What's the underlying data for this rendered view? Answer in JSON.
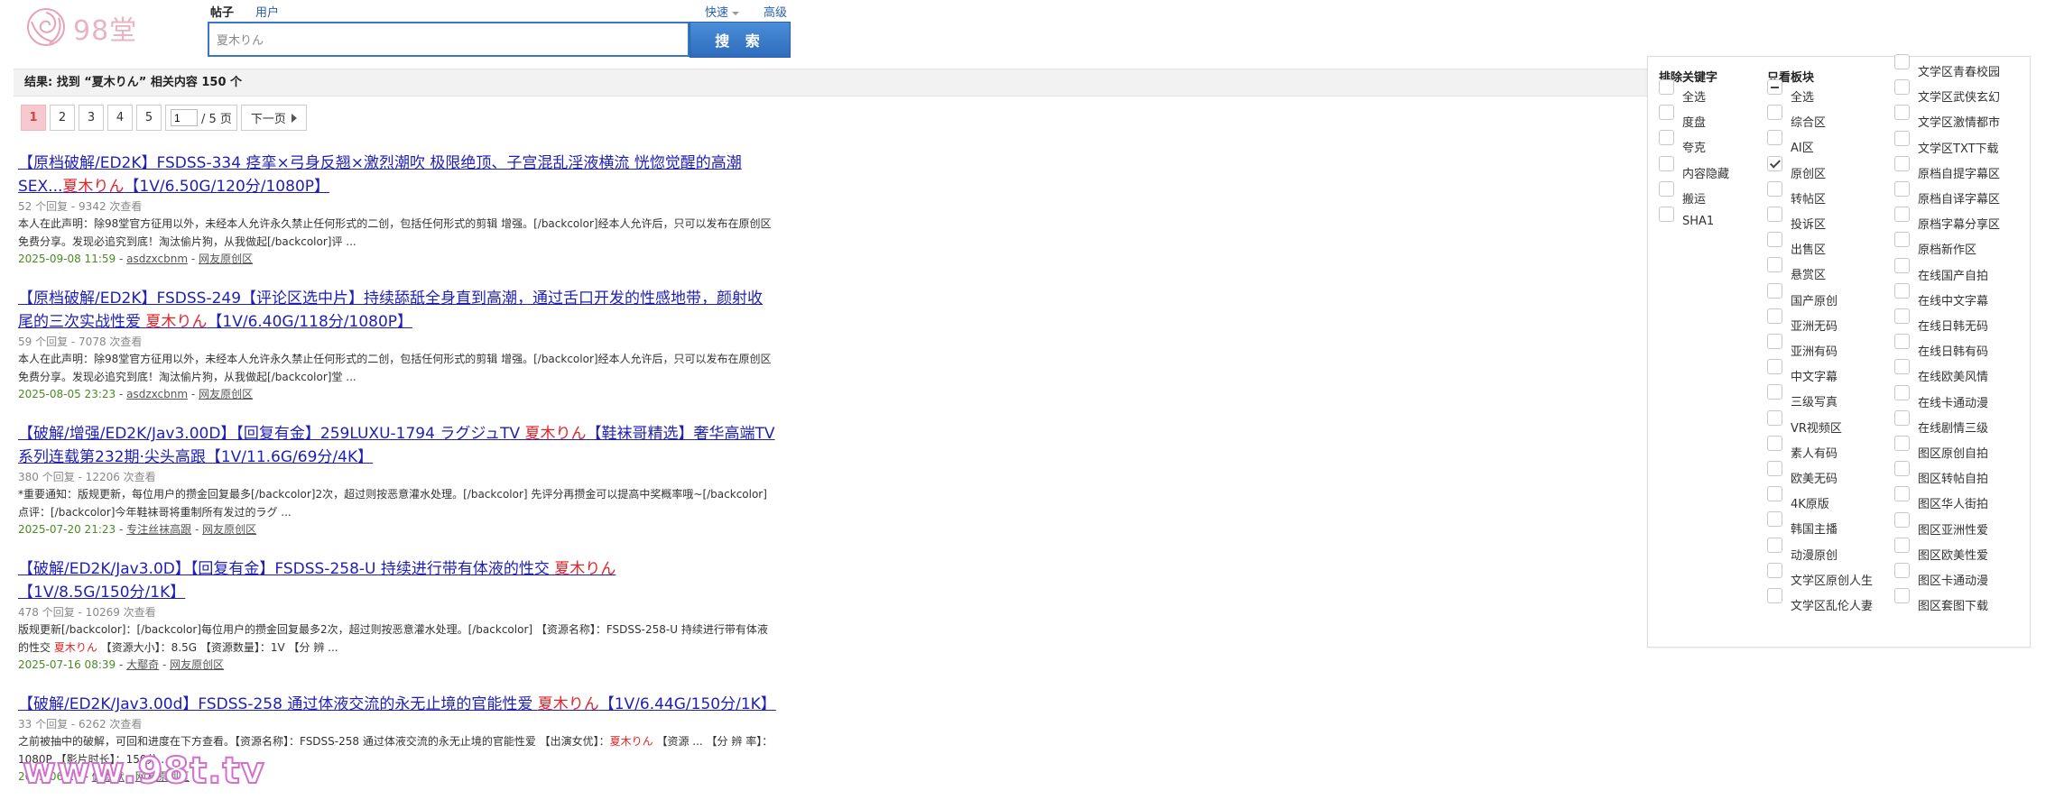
{
  "header": {
    "logo_text": "98堂",
    "tabs": [
      {
        "label": "帖子",
        "active": true
      },
      {
        "label": "用户",
        "active": false
      }
    ],
    "quick_label": "快速",
    "advanced_label": "高级",
    "search_value": "夏木りん",
    "search_button": "搜 索"
  },
  "result_summary": "结果: 找到 “夏木りん” 相关内容 150 个",
  "pager": {
    "pages": [
      "1",
      "2",
      "3",
      "4",
      "5"
    ],
    "current": "1",
    "page_input": "1",
    "total_text": "/ 5 页",
    "next_label": "下一页"
  },
  "results": [
    {
      "title_before": "【原档破解/ED2K】FSDSS-334 痉挛×弓身反翘×激烈潮吹 极限绝顶、子宫混乱淫液横流 恍惚觉醒的高潮SEX...",
      "title_hl": "夏木りん",
      "title_after": "【1V/6.50G/120分/1080P】",
      "meta": "52 个回复 - 9342 次查看",
      "snippet_before": "本人在此声明：除98堂官方征用以外，未经本人允许永久禁止任何形式的二创，包括任何形式的剪辑 增强。[/backcolor]经本人允许后，只可以发布在原创区免费分享。发现必追究到底！淘汰偷片狗，从我做起[/backcolor]评 ...",
      "snippet_hl": "",
      "snippet_after": "",
      "date": "2025-09-08 11:59",
      "author": "asdzxcbnm",
      "forum": "网友原创区"
    },
    {
      "title_before": "【原档破解/ED2K】FSDSS-249【评论区选中片】持续舔舐全身直到高潮，通过舌口开发的性感地带，颜射收尾的三次实战性爱 ",
      "title_hl": "夏木りん",
      "title_after": "【1V/6.40G/118分/1080P】",
      "meta": "59 个回复 - 7078 次查看",
      "snippet_before": "本人在此声明：除98堂官方征用以外，未经本人允许永久禁止任何形式的二创，包括任何形式的剪辑 增强。[/backcolor]经本人允许后，只可以发布在原创区免费分享。发现必追究到底！淘汰偷片狗，从我做起[/backcolor]堂 ...",
      "snippet_hl": "",
      "snippet_after": "",
      "date": "2025-08-05 23:23",
      "author": "asdzxcbnm",
      "forum": "网友原创区"
    },
    {
      "title_before": "【破解/增强/ED2K/Jav3.00D】【回复有金】259LUXU-1794 ラグジュTV ",
      "title_hl": "夏木りん",
      "title_after": "【鞋袜哥精选】奢华高端TV系列连载第232期·尖头高跟【1V/11.6G/69分/4K】",
      "meta": "380 个回复 - 12206 次查看",
      "snippet_before": "*重要通知：版规更新，每位用户的攒金回复最多[/backcolor]2次，超过则按恶意灌水处理。[/backcolor] 先评分再攒金可以提高中奖概率哦~[/backcolor] 点评：[/backcolor]今年鞋袜哥将重制所有发过的ラグ ...",
      "snippet_hl": "",
      "snippet_after": "",
      "date": "2025-07-20 21:23",
      "author": "专注丝袜高跟",
      "forum": "网友原创区"
    },
    {
      "title_before": "【破解/ED2K/Jav3.0D】【回复有金】FSDSS-258-U 持续进行带有体液的性交 ",
      "title_hl": "夏木りん",
      "title_after": "【1V/8.5G/150分/1K】",
      "meta": "478 个回复 - 10269 次查看",
      "snippet_before": "版规更新[/backcolor]：[/backcolor]每位用户的攒金回复最多2次，超过则按恶意灌水处理。[/backcolor] 【资源名称】：FSDSS-258-U 持续进行带有体液的性交 ",
      "snippet_hl": "夏木りん",
      "snippet_after": " 【资源大小】：8.5G 【资源数量】：1V 【分 辨 ...",
      "date": "2025-07-16 08:39",
      "author": "大鄢奇",
      "forum": "网友原创区"
    },
    {
      "title_before": "【破解/ED2K/Jav3.00d】FSDSS-258 通过体液交流的永无止境的官能性爱 ",
      "title_hl": "夏木りん",
      "title_after": "【1V/6.44G/150分/1K】",
      "meta": "33 个回复 - 6262 次查看",
      "snippet_before": "之前被抽中的破解，可回和进度在下方查看。【资源名称】：FSDSS-258 通过体液交流的永无止境的官能性爱 【出演女优】：",
      "snippet_hl": "夏木りん",
      "snippet_after": " 【资源 ... 【分 辨 率】：1080P 【影片时长】：150分 ...",
      "date": "2025-06-16",
      "author": "佩默默",
      "forum": "网友原创区"
    }
  ],
  "filter_panel": {
    "exclude_heading": "排除关键字",
    "exclude_items": [
      {
        "label": "全选",
        "state": "unchecked"
      },
      {
        "label": "度盘",
        "state": "unchecked"
      },
      {
        "label": "夸克",
        "state": "unchecked"
      },
      {
        "label": "内容隐藏",
        "state": "unchecked"
      },
      {
        "label": "搬运",
        "state": "unchecked"
      },
      {
        "label": "SHA1",
        "state": "unchecked"
      }
    ],
    "only_heading": "只看板块",
    "only_items_col1": [
      {
        "label": "全选",
        "state": "partial"
      },
      {
        "label": "综合区",
        "state": "unchecked"
      },
      {
        "label": "AI区",
        "state": "unchecked"
      },
      {
        "label": "原创区",
        "state": "checked"
      },
      {
        "label": "转帖区",
        "state": "unchecked"
      },
      {
        "label": "投诉区",
        "state": "unchecked"
      },
      {
        "label": "出售区",
        "state": "unchecked"
      },
      {
        "label": "悬赏区",
        "state": "unchecked"
      },
      {
        "label": "国产原创",
        "state": "unchecked"
      },
      {
        "label": "亚洲无码",
        "state": "unchecked"
      },
      {
        "label": "亚洲有码",
        "state": "unchecked"
      },
      {
        "label": "中文字幕",
        "state": "unchecked"
      },
      {
        "label": "三级写真",
        "state": "unchecked"
      },
      {
        "label": "VR视频区",
        "state": "unchecked"
      },
      {
        "label": "素人有码",
        "state": "unchecked"
      },
      {
        "label": "欧美无码",
        "state": "unchecked"
      },
      {
        "label": "4K原版",
        "state": "unchecked"
      },
      {
        "label": "韩国主播",
        "state": "unchecked"
      },
      {
        "label": "动漫原创",
        "state": "unchecked"
      },
      {
        "label": "文学区原创人生",
        "state": "unchecked"
      },
      {
        "label": "文学区乱伦人妻",
        "state": "unchecked"
      }
    ],
    "only_items_col2": [
      {
        "label": "文学区青春校园",
        "state": "unchecked"
      },
      {
        "label": "文学区武侠玄幻",
        "state": "unchecked"
      },
      {
        "label": "文学区激情都市",
        "state": "unchecked"
      },
      {
        "label": "文学区TXT下载",
        "state": "unchecked"
      },
      {
        "label": "原档自提字幕区",
        "state": "unchecked"
      },
      {
        "label": "原档自译字幕区",
        "state": "unchecked"
      },
      {
        "label": "原档字幕分享区",
        "state": "unchecked"
      },
      {
        "label": "原档新作区",
        "state": "unchecked"
      },
      {
        "label": "在线国产自拍",
        "state": "unchecked"
      },
      {
        "label": "在线中文字幕",
        "state": "unchecked"
      },
      {
        "label": "在线日韩无码",
        "state": "unchecked"
      },
      {
        "label": "在线日韩有码",
        "state": "unchecked"
      },
      {
        "label": "在线欧美风情",
        "state": "unchecked"
      },
      {
        "label": "在线卡通动漫",
        "state": "unchecked"
      },
      {
        "label": "在线剧情三级",
        "state": "unchecked"
      },
      {
        "label": "图区原创自拍",
        "state": "unchecked"
      },
      {
        "label": "图区转帖自拍",
        "state": "unchecked"
      },
      {
        "label": "图区华人街拍",
        "state": "unchecked"
      },
      {
        "label": "图区亚洲性爱",
        "state": "unchecked"
      },
      {
        "label": "图区欧美性爱",
        "state": "unchecked"
      },
      {
        "label": "图区卡通动漫",
        "state": "unchecked"
      },
      {
        "label": "图区套图下载",
        "state": "unchecked"
      }
    ]
  },
  "watermark": {
    "text": "www.98t.tv"
  },
  "colors": {
    "link": "#1f1fb4",
    "highlight": "#e0242a",
    "accent_blue": "#3677c8",
    "date_green": "#4a8a24",
    "current_page": "#f7c9cf"
  }
}
